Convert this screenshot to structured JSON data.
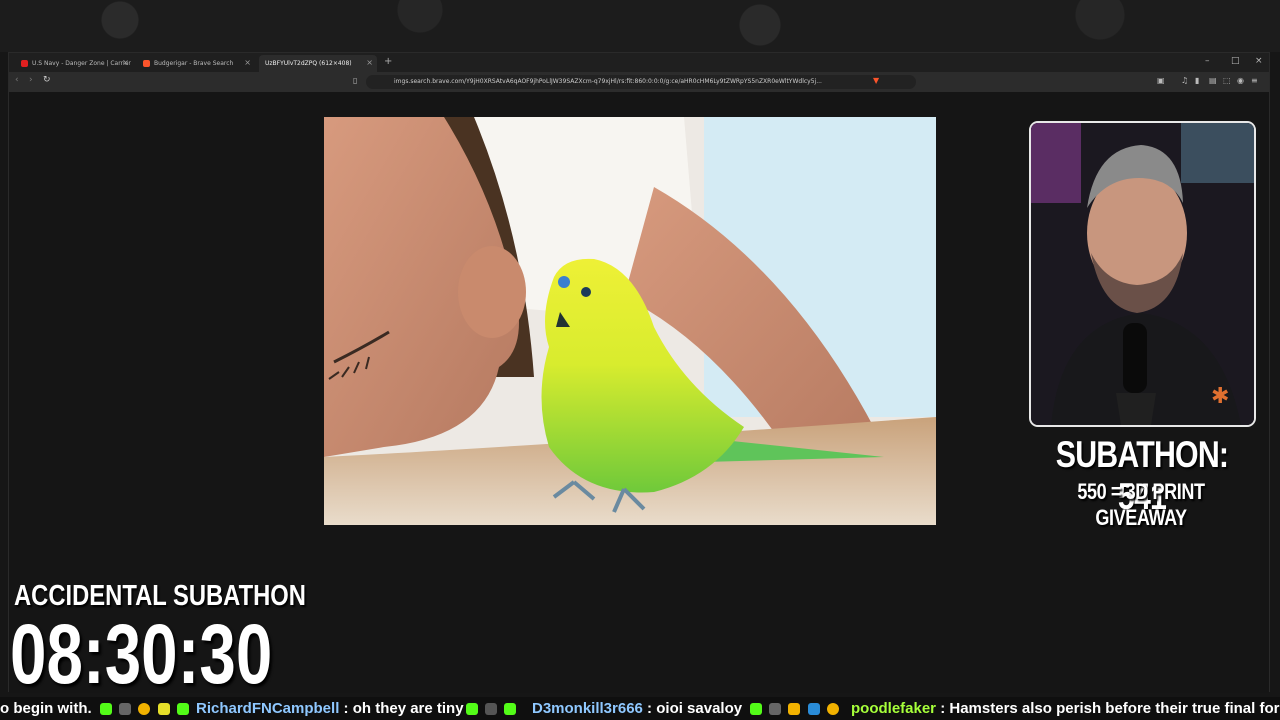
{
  "browser": {
    "tabs": [
      {
        "title": "U.S Navy - Danger Zone | Carrier",
        "active": false
      },
      {
        "title": "Budgerigar - Brave Search",
        "active": false
      },
      {
        "title": "UzBFYUlvT2dZPQ (612×408)",
        "active": true
      }
    ],
    "url": "imgs.search.brave.com/Y9jH0XRSAtvA6qAOF9jhPoLlJW39SAZXcm-q79xjHl/rs:fit:860:0:0:0/g:ce/aHR0cHM6Ly9tZWRpYS5nZXR0eWltYWdlcy5j...",
    "window_controls": [
      "–",
      "□",
      "×"
    ]
  },
  "overlay": {
    "subathon_count": "SUBATHON: 541",
    "subathon_goal": "550 = 3D PRINT GIVEAWAY",
    "accidental_title": "ACCIDENTAL SUBATHON",
    "timer": "08:30:30"
  },
  "chat_ticker": [
    {
      "user": "",
      "message": "o begin with.",
      "user_color": "#ffffff"
    },
    {
      "user": "RichardFNCampbell",
      "message": "oh they are tiny",
      "user_color": "#8fc8ff"
    },
    {
      "user": "D3monkill3r666",
      "message": "oioi savaloy",
      "user_color": "#8fc8ff"
    },
    {
      "user": "poodlefaker",
      "message": "Hamsters also perish before their true final form",
      "user_color": "#a6ff3a"
    }
  ],
  "colors": {
    "accent_green": "#53fc18",
    "budgie_yellow": "#e6f03a",
    "budgie_green": "#7cd23a"
  }
}
